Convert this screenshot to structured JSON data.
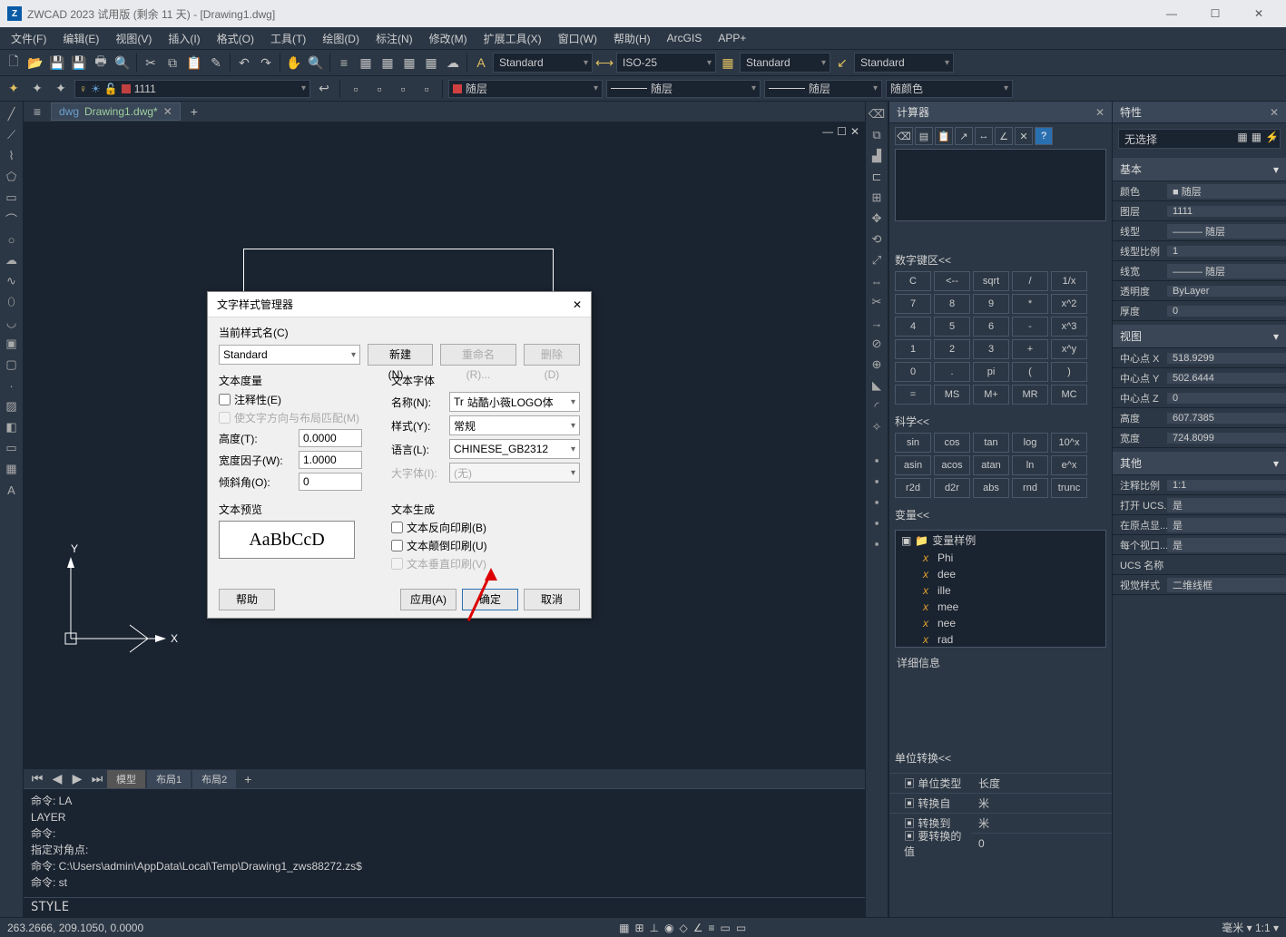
{
  "title": "ZWCAD 2023 试用版 (剩余 11 天) - [Drawing1.dwg]",
  "menu": [
    "文件(F)",
    "编辑(E)",
    "视图(V)",
    "插入(I)",
    "格式(O)",
    "工具(T)",
    "绘图(D)",
    "标注(N)",
    "修改(M)",
    "扩展工具(X)",
    "窗口(W)",
    "帮助(H)",
    "ArcGIS",
    "APP+"
  ],
  "style_combo1": "Standard",
  "style_combo2": "ISO-25",
  "style_combo3": "Standard",
  "style_combo4": "Standard",
  "layer_name": "1111",
  "layer_follow": "随层",
  "layer_color": "随颜色",
  "doctab": "Drawing1.dwg*",
  "bottom_tabs": {
    "model": "模型",
    "layout1": "布局1",
    "layout2": "布局2"
  },
  "cmd_lines": [
    "命令: LA",
    "LAYER",
    "命令:",
    "指定对角点:",
    "命令: C:\\Users\\admin\\AppData\\Local\\Temp\\Drawing1_zws88272.zs$",
    "命令: st"
  ],
  "cmd_input": "STYLE",
  "coords": "263.2666, 209.1050,  0.0000",
  "calc": {
    "title": "计算器",
    "numeric_hdr": "数字键区<<",
    "keys_num": [
      [
        "C",
        "<--",
        "sqrt",
        "/",
        "1/x"
      ],
      [
        "7",
        "8",
        "9",
        "*",
        "x^2"
      ],
      [
        "4",
        "5",
        "6",
        "-",
        "x^3"
      ],
      [
        "1",
        "2",
        "3",
        "+",
        "x^y"
      ],
      [
        "0",
        ".",
        "pi",
        "(",
        ")"
      ],
      [
        "=",
        "MS",
        "M+",
        "MR",
        "MC"
      ]
    ],
    "sci_hdr": "科学<<",
    "keys_sci": [
      [
        "sin",
        "cos",
        "tan",
        "log",
        "10^x"
      ],
      [
        "asin",
        "acos",
        "atan",
        "ln",
        "e^x"
      ],
      [
        "r2d",
        "d2r",
        "abs",
        "rnd",
        "trunc"
      ]
    ],
    "var_hdr": "变量<<",
    "var_root": "变量样例",
    "vars": [
      "Phi",
      "dee",
      "ille",
      "mee",
      "nee",
      "rad"
    ],
    "detail": "详细信息",
    "unit_hdr": "单位转换<<",
    "unit_rows": [
      [
        "单位类型",
        "长度"
      ],
      [
        "转换自",
        "米"
      ],
      [
        "转换到",
        "米"
      ],
      [
        "要转换的值",
        "0"
      ]
    ]
  },
  "props": {
    "title": "特性",
    "nosel": "无选择",
    "basic": "基本",
    "rows_basic": [
      [
        "颜色",
        "■ 随层"
      ],
      [
        "图层",
        "1111"
      ],
      [
        "线型",
        "——— 随层"
      ],
      [
        "线型比例",
        "1"
      ],
      [
        "线宽",
        "——— 随层"
      ],
      [
        "透明度",
        "ByLayer"
      ],
      [
        "厚度",
        "0"
      ]
    ],
    "view": "视图",
    "rows_view": [
      [
        "中心点 X",
        "518.9299"
      ],
      [
        "中心点 Y",
        "502.6444"
      ],
      [
        "中心点 Z",
        "0"
      ],
      [
        "高度",
        "607.7385"
      ],
      [
        "宽度",
        "724.8099"
      ]
    ],
    "other": "其他",
    "rows_other": [
      [
        "注释比例",
        "1:1"
      ],
      [
        "打开 UCS...",
        "是"
      ],
      [
        "在原点显...",
        "是"
      ],
      [
        "每个视口...",
        "是"
      ],
      [
        "UCS 名称",
        ""
      ],
      [
        "视觉样式",
        "二维线框"
      ]
    ]
  },
  "dialog": {
    "title": "文字样式管理器",
    "current_lbl": "当前样式名(C)",
    "current_val": "Standard",
    "btn_new": "新建(N)...",
    "btn_rename": "重命名(R)...",
    "btn_delete": "删除(D)",
    "grp_measure": "文本度量",
    "cb_annot": "注释性(E)",
    "cb_match": "使文字方向与布局匹配(M)",
    "height_lbl": "高度(T):",
    "height_val": "0.0000",
    "width_lbl": "宽度因子(W):",
    "width_val": "1.0000",
    "oblique_lbl": "倾斜角(O):",
    "oblique_val": "0",
    "grp_font": "文本字体",
    "name_lbl": "名称(N):",
    "name_val": "站酷小薇LOGO体",
    "style_lbl": "样式(Y):",
    "style_val": "常规",
    "lang_lbl": "语言(L):",
    "lang_val": "CHINESE_GB2312",
    "big_lbl": "大字体(I):",
    "big_val": "(无)",
    "grp_preview": "文本预览",
    "preview_text": "AaBbCcD",
    "grp_gen": "文本生成",
    "cb_backward": "文本反向印刷(B)",
    "cb_upside": "文本颠倒印刷(U)",
    "cb_vertical": "文本垂直印刷(V)",
    "btn_help": "帮助",
    "btn_apply": "应用(A)",
    "btn_ok": "确定",
    "btn_cancel": "取消"
  },
  "status_right": "毫米 ▾    1:1 ▾"
}
